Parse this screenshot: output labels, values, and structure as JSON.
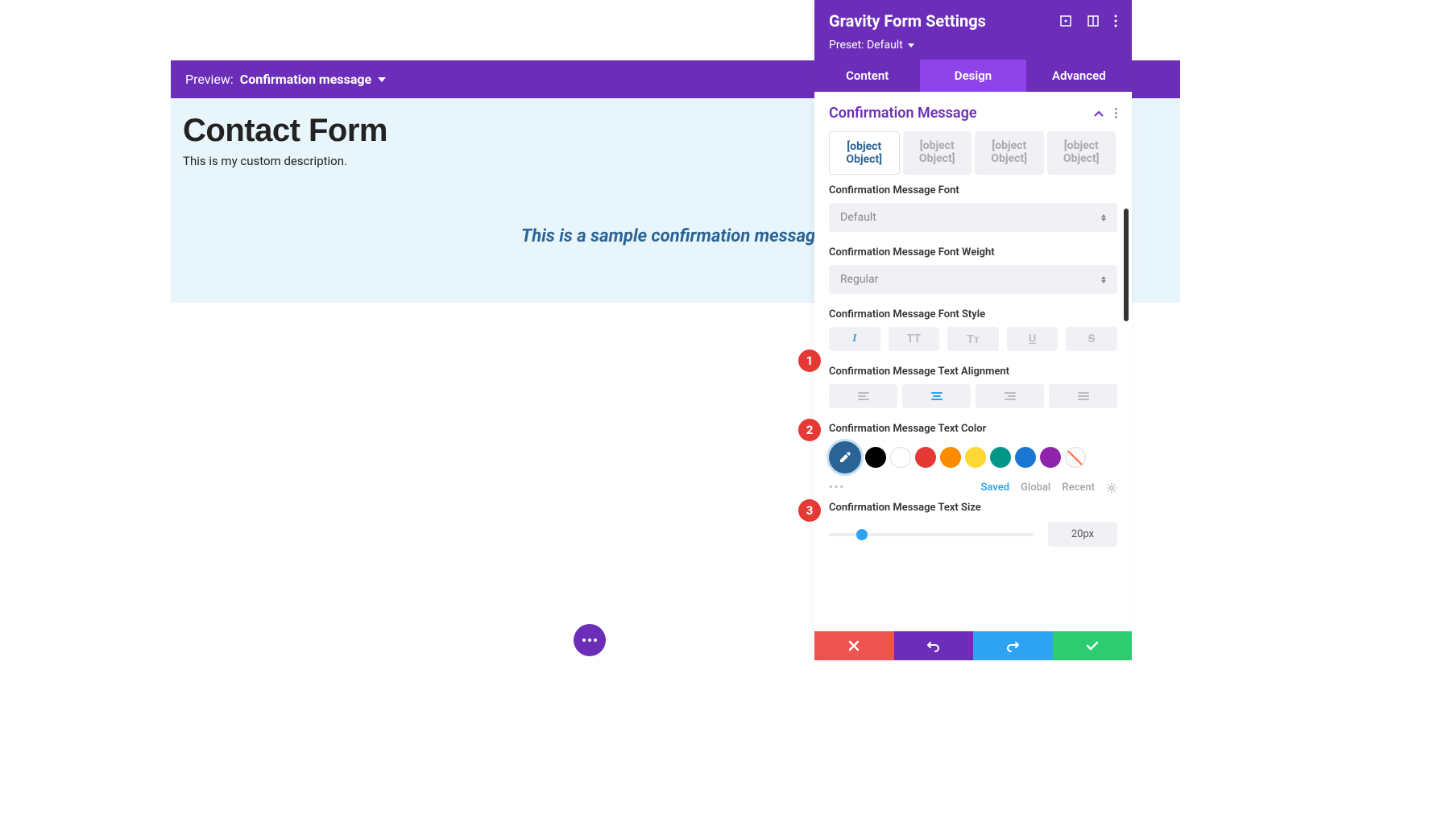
{
  "preview": {
    "label": "Preview:",
    "value": "Confirmation message"
  },
  "form": {
    "title": "Contact Form",
    "description": "This is my custom description.",
    "confirmation_message": "This is a sample confirmation message."
  },
  "panel": {
    "title": "Gravity Form Settings",
    "preset_label": "Preset:",
    "preset_value": "Default"
  },
  "tabs": {
    "content": "Content",
    "design": "Design",
    "advanced": "Advanced"
  },
  "section": {
    "title": "Confirmation Message"
  },
  "subtabs": {
    "a": "[object Object]",
    "b": "[object Object]",
    "c": "[object Object]",
    "d": "[object Object]"
  },
  "settings": {
    "font_label": "Confirmation Message Font",
    "font_value": "Default",
    "weight_label": "Confirmation Message Font Weight",
    "weight_value": "Regular",
    "style_label": "Confirmation Message Font Style",
    "align_label": "Confirmation Message Text Alignment",
    "color_label": "Confirmation Message Text Color",
    "size_label": "Confirmation Message Text Size",
    "size_value": "20px"
  },
  "style_buttons": {
    "italic": "I",
    "uppercase": "TT",
    "smallcaps": "Tᴛ",
    "underline": "U",
    "strike": "S"
  },
  "colors": {
    "current": "#2a6496",
    "swatches": [
      "#000000",
      "#ffffff",
      "#e53935",
      "#fb8c00",
      "#fdd835",
      "#009688",
      "#1976d2",
      "#8e24aa"
    ]
  },
  "color_tabs": {
    "more": "•••",
    "saved": "Saved",
    "global": "Global",
    "recent": "Recent"
  },
  "annotations": {
    "b1": "1",
    "b2": "2",
    "b3": "3"
  }
}
